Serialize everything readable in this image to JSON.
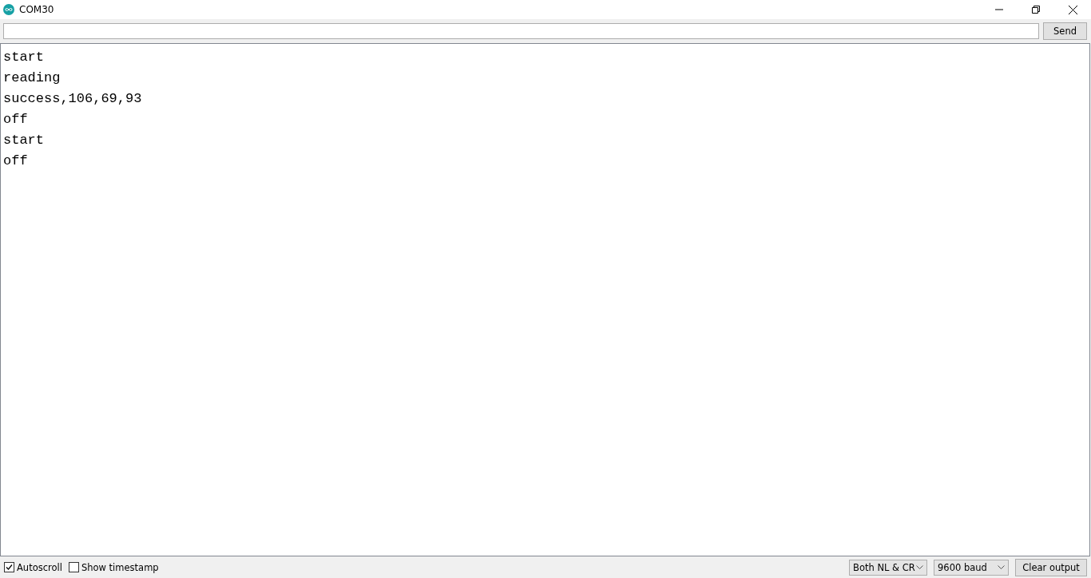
{
  "window": {
    "title": "COM30"
  },
  "send_button": "Send",
  "output_lines": [
    "start",
    "reading",
    "success,106,69,93",
    "off",
    "start",
    "off"
  ],
  "footer": {
    "checkboxes": [
      {
        "label": "Autoscroll",
        "checked": true
      },
      {
        "label": "Show timestamp",
        "checked": false
      }
    ],
    "line_ending": "Both NL & CR",
    "baud_rate": "9600 baud",
    "clear_button": "Clear output"
  }
}
